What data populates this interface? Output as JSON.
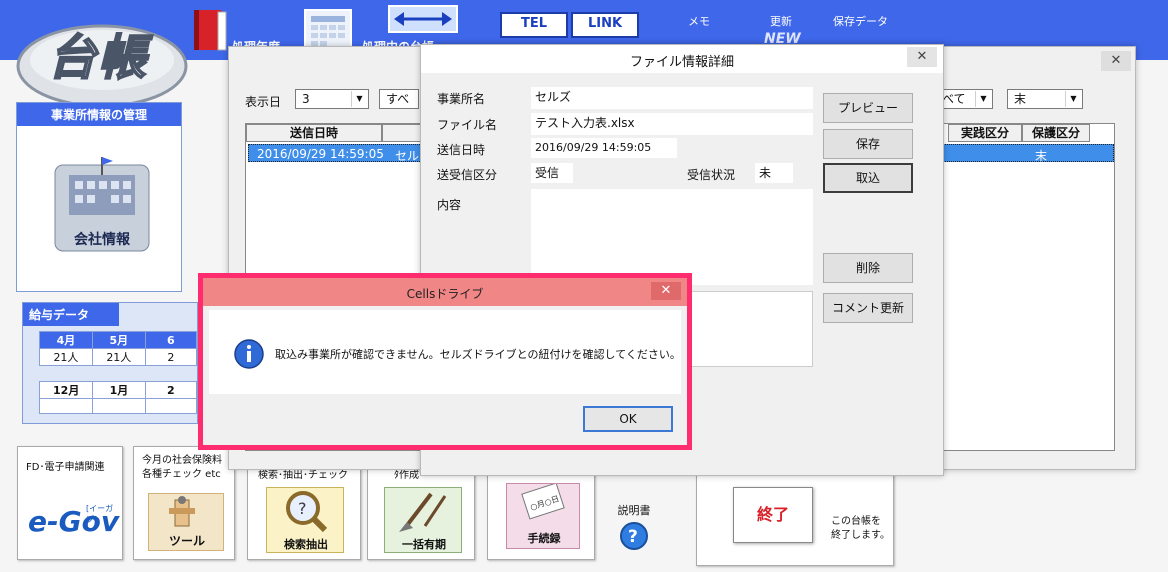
{
  "app": {
    "logo_text": "台帳",
    "toolbar": {
      "shori_nendo": "処理年度",
      "shori_chu": "処理中の台帳",
      "tel": "TEL",
      "link": "LINK",
      "memo": "メモ",
      "koushin": "更新",
      "koushin_badge": "NEW",
      "hozon_data": "保存データ"
    }
  },
  "left": {
    "company_panel": {
      "title": "事業所情報の管理",
      "button_label": "会社情報"
    },
    "salary_panel": {
      "title": "給与データ",
      "row1_months": [
        "4月",
        "5月",
        "6"
      ],
      "row1_values": [
        "21人",
        "21人",
        "2"
      ],
      "row2_months": [
        "12月",
        "1月",
        "2"
      ],
      "row2_values": [
        "",
        "",
        ""
      ]
    }
  },
  "tiles": {
    "egov": {
      "caption": "FD･電子申請関連",
      "logo": "e-Gov",
      "logo_sub": "[イーガブ]"
    },
    "check": {
      "caption1": "今月の社会保険料",
      "caption2": "各種チェック etc",
      "label": "ツール"
    },
    "search": {
      "caption": "検索･抽出･チェック",
      "label": "検索抽出"
    },
    "bulk": {
      "caption": "ﾀ作成 ･･･",
      "label": "一括有期"
    },
    "procedure": {
      "label": "手続録",
      "card_text": "○月○日"
    },
    "manual": {
      "label": "説明書"
    },
    "exit": {
      "button": "終了",
      "note1": "この台帳を",
      "note2": "終了します。"
    }
  },
  "list_window": {
    "filter_label": "表示日",
    "filter_days": "3",
    "filter_type": "すべ",
    "filter_right_1": "べて",
    "filter_right_2": "末",
    "columns": {
      "sent_at": "送信日時",
      "status": "実践区分",
      "protect": "保護区分"
    },
    "row": {
      "sent_at": "2016/09/29 14:59:05",
      "company": "セルズ",
      "protect": "末"
    }
  },
  "detail_window": {
    "title": "ファイル情報詳細",
    "company_label": "事業所名",
    "company_value": "セルズ",
    "file_label": "ファイル名",
    "file_value": "テスト入力表.xlsx",
    "sent_label": "送信日時",
    "sent_value": "2016/09/29 14:59:05",
    "direction_label": "送受信区分",
    "direction_value": "受信",
    "status_label": "受信状況",
    "status_value": "未",
    "content_label": "内容",
    "buttons": {
      "preview": "プレビュー",
      "save": "保存",
      "import": "取込",
      "delete": "削除",
      "comment_update": "コメント更新"
    }
  },
  "dialog": {
    "title": "Cellsドライブ",
    "message": "取込み事業所が確認できません。セルズドライブとの紐付けを確認してください。",
    "ok": "OK",
    "highlight_color": "#ff2d6f"
  }
}
